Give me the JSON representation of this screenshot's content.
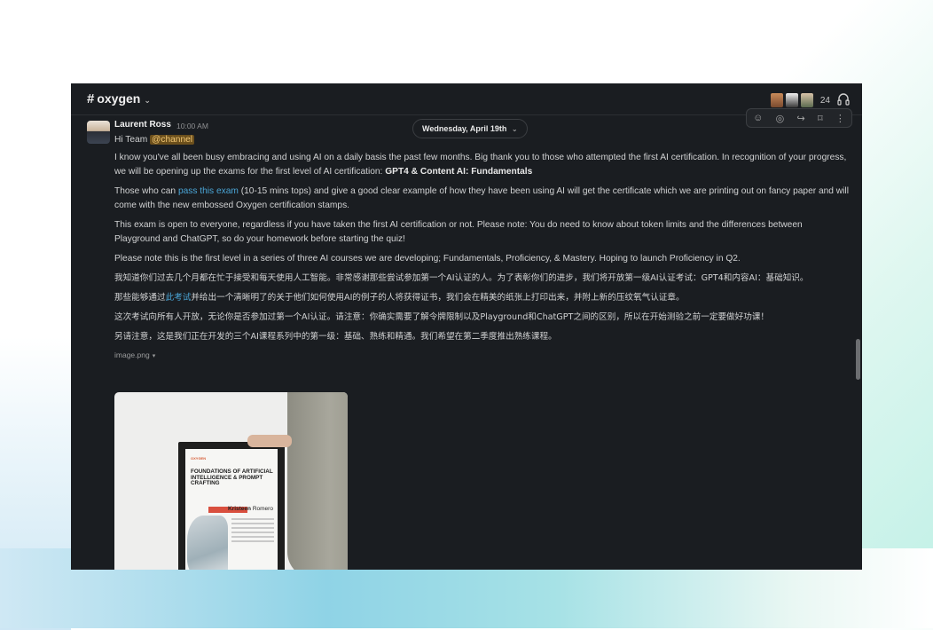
{
  "header": {
    "hash": "#",
    "channel": "oxygen",
    "chevron": "⌄",
    "member_count": "24"
  },
  "date_pill": "Wednesday, April 19th",
  "message": {
    "sender": "Laurent Ross",
    "time": "10:00 AM",
    "greeting": "Hi Team",
    "mention": "@channel",
    "p1": "I know you've all been busy embracing and using AI on a daily basis the past few months. Big thank you to those who attempted the first AI certification. In recognition of your progress, we will be opening up the exams for the first level of AI certification:",
    "p1_bold": "GPT4 & Content AI: Fundamentals",
    "p2_pre": "Those who can",
    "p2_link": "pass this exam",
    "p2_post": "(10-15 mins tops) and give a good clear example of how they have been using AI will get the certificate which we are printing out on fancy paper and will come with the new embossed Oxygen certification stamps.",
    "p3": "This exam is open to everyone, regardless if you have taken the first AI certification or not. Please note: You do need to know about token limits and the differences between Playground and ChatGPT, so do your homework before starting the quiz!",
    "p4": "Please note this is the first level in a series of three AI courses we are developing; Fundamentals, Proficiency, & Mastery. Hoping to launch Proficiency in Q2.",
    "zh1": "我知道你们过去几个月都在忙于接受和每天使用人工智能。非常感谢那些尝试参加第一个AI认证的人。为了表彰你们的进步，我们将开放第一级AI认证考试：GPT4和内容AI：基础知识。",
    "zh2_pre": "那些能够通过",
    "zh2_link": "此考试",
    "zh2_post": "并给出一个清晰明了的关于他们如何使用AI的例子的人将获得证书，我们会在精美的纸张上打印出来，并附上新的压纹氧气认证章。",
    "zh3": "这次考试向所有人开放，无论你是否参加过第一个AI认证。请注意：你确实需要了解令牌限制以及Playground和ChatGPT之间的区别，所以在开始测验之前一定要做好功课！",
    "zh4": "另请注意，这是我们正在开发的三个AI课程系列中的第一级：基础、熟练和精通。我们希望在第二季度推出熟练课程。",
    "file_name": "image.png",
    "file_caret": "▾"
  },
  "certificate": {
    "logo": "OXYGEN",
    "title": "FOUNDATIONS OF ARTIFICIAL INTELLIGENCE & PROMPT CRAFTING",
    "name_bold": "Kristeen",
    "name_rest": "Romero"
  },
  "actions": [
    "☺",
    "◎",
    "↪",
    "⌑",
    "⋮"
  ],
  "colors": {
    "window_bg": "#1a1d21",
    "link": "#4aa5d6",
    "mention_bg": "#6b4f1c",
    "mention_fg": "#f2c774"
  }
}
